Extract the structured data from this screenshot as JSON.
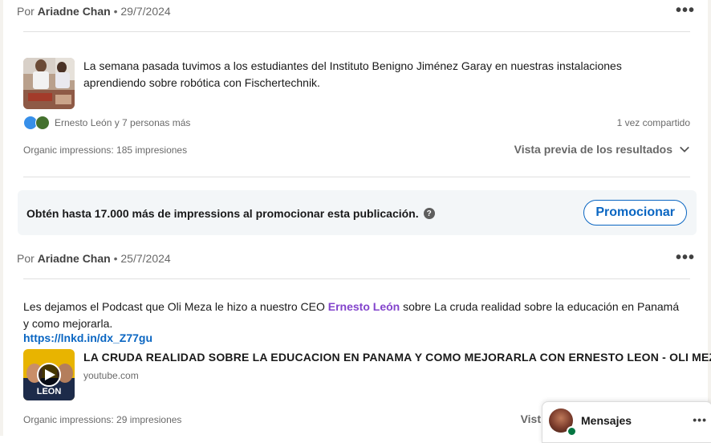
{
  "post1": {
    "author_prefix": "Por",
    "author": "Ariadne Chan",
    "date_sep": "•",
    "date": "29/7/2024",
    "more_icon": "ellipsis-icon",
    "text": "La semana pasada tuvimos a los estudiantes del Instituto Benigno Jiménez Garay en nuestras instalaciones aprendiendo sobre robótica con Fischertechnik.",
    "reactions_text": "Ernesto León y 7 personas más",
    "shares": "1 vez compartido",
    "impressions": "Organic impressions: 185 impresiones",
    "preview_label": "Vista previa de los resultados"
  },
  "promo": {
    "text": "Obtén hasta 17.000 más de impressions al promocionar esta publicación.",
    "help_icon": "question-icon",
    "button_label": "Promocionar",
    "accent": "#0a66c2"
  },
  "post2": {
    "author_prefix": "Por",
    "author": "Ariadne Chan",
    "date_sep": "•",
    "date": "25/7/2024",
    "text_before": "Les dejamos el Podcast que Oli Meza le hizo a nuestro CEO",
    "mention": "Ernesto León",
    "text_after": "sobre La cruda realidad sobre la educación en Panamá y como mejorarla.",
    "link": "https://lnkd.in/dx_Z77gu",
    "video_title": "LA CRUDA REALIDAD SOBRE LA EDUCACION EN PANAMA Y COMO MEJORARLA CON ERNESTO LEON - OLI MEZA P...",
    "video_source": "youtube.com",
    "thumb_text": "LEON",
    "impressions": "Organic impressions: 29 impresiones",
    "preview_label": "Vist"
  },
  "messenger": {
    "label": "Mensajes",
    "more": "•••"
  }
}
